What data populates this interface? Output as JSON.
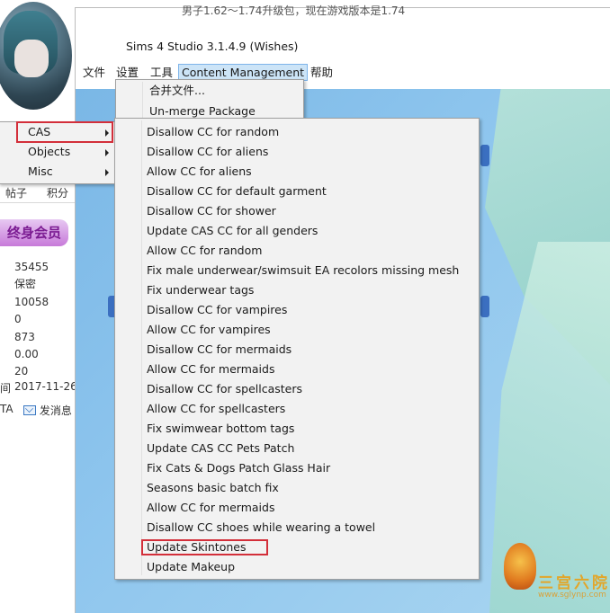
{
  "forum": {
    "tabs": [
      "帖子",
      "积分"
    ],
    "badge": "终身会员",
    "stats": [
      "35455",
      "保密",
      "10058",
      "0",
      "873",
      "0.00",
      "20"
    ],
    "date_label": "间",
    "date": "2017-11-26",
    "ta_label": "TA",
    "message_label": "发消息"
  },
  "app": {
    "top_cut_text": "男子1.62～1.74升级包，现在游戏版本是1.74",
    "title": "Sims 4 Studio 3.1.4.9 (Wishes)",
    "menubar": [
      "文件",
      "设置",
      "工具",
      "Content Management",
      "帮助"
    ]
  },
  "content_menu": {
    "items": [
      "合并文件...",
      "Un-merge Package"
    ]
  },
  "side_menu": {
    "items": [
      "CAS",
      "Objects",
      "Misc"
    ]
  },
  "cas_menu": {
    "items": [
      "Disallow CC for random",
      "Disallow CC for aliens",
      "Allow CC for aliens",
      "Disallow CC for default garment",
      "Disallow CC for shower",
      "Update CAS CC for all genders",
      "Allow CC for random",
      "Fix male underwear/swimsuit EA recolors missing mesh",
      "Fix underwear tags",
      "Disallow CC for vampires",
      "Allow CC for vampires",
      "Disallow CC for mermaids",
      "Allow CC for mermaids",
      "Disallow CC for spellcasters",
      "Allow CC for spellcasters",
      "Fix swimwear bottom tags",
      "Update CAS CC Pets Patch",
      "Fix Cats & Dogs Patch Glass Hair",
      "Seasons basic batch fix",
      "Allow CC for mermaids",
      "Disallow CC shoes while wearing a towel",
      "Update Skintones",
      "Update Makeup"
    ]
  },
  "watermark": {
    "title": "三宫六院",
    "url": "www.sglynp.com"
  },
  "colors": {
    "highlight": "#d32f3a",
    "menu_active": "#cce4f7",
    "canvas": "#8fc6ee"
  }
}
